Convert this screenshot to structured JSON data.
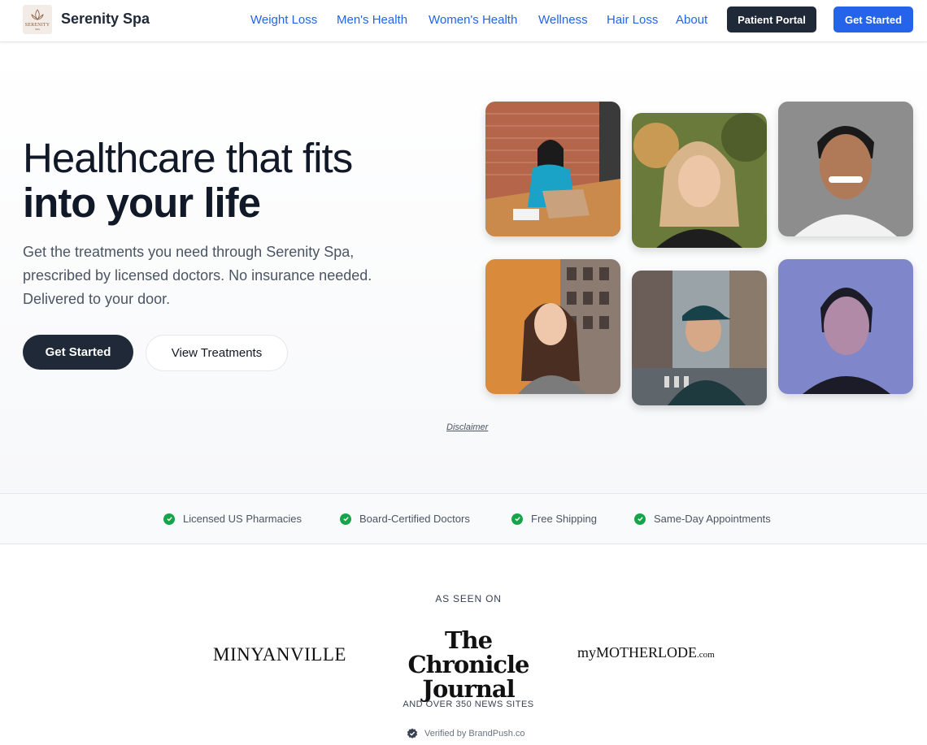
{
  "header": {
    "logo_text": "SERENITY",
    "logo_subtext": "SPA",
    "brand": "Serenity Spa",
    "nav": [
      "Weight Loss",
      "Men's Health",
      "Women's Health",
      "Wellness",
      "Hair Loss",
      "About"
    ],
    "portal_label": "Patient Portal",
    "cta_label": "Get Started"
  },
  "hero": {
    "title_line1": "Healthcare that fits",
    "title_line2": "into your life",
    "subtitle": "Get the treatments you need through Serenity Spa, prescribed by licensed doctors. No insurance needed. Delivered to your door.",
    "primary_cta": "Get Started",
    "secondary_cta": "View Treatments",
    "disclaimer": "Disclaimer",
    "photos": [
      "woman-at-laptop",
      "smiling-blonde-woman",
      "smiling-man",
      "woman-by-window",
      "man-in-cap",
      "woman-blue-light"
    ]
  },
  "trust": {
    "items": [
      "Licensed US Pharmacies",
      "Board-Certified Doctors",
      "Free Shipping",
      "Same-Day Appointments"
    ]
  },
  "press": {
    "title": "AS SEEN ON",
    "publications": [
      "MINYANVILLE",
      "The Chronicle Journal",
      "myMOTHERLODE.com"
    ],
    "pub2_line1": "The Chronicle",
    "pub2_line2": "Journal",
    "pub3_main": "myMOTHERLODE",
    "pub3_suffix": ".com",
    "more": "AND OVER 350 NEWS SITES",
    "verified": "Verified by BrandPush.co"
  },
  "colors": {
    "accent": "#2563eb",
    "dark": "#1f2937",
    "check": "#16a34a"
  }
}
